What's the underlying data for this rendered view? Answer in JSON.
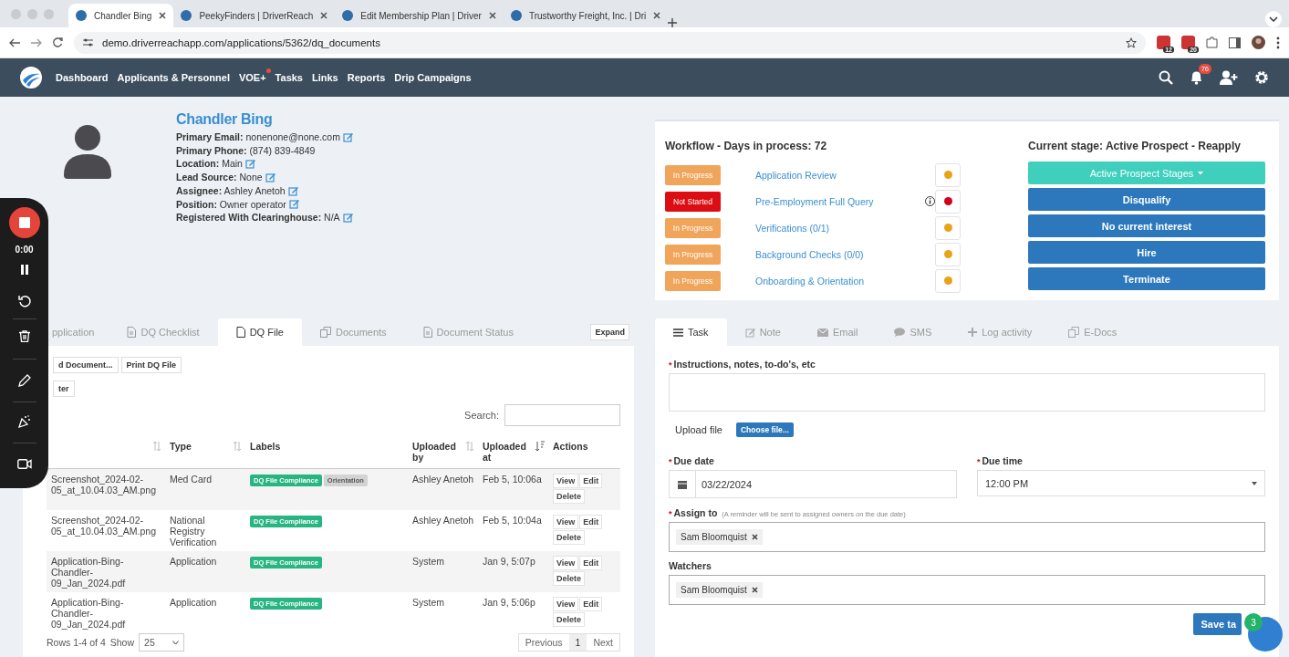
{
  "browser": {
    "tabs": [
      {
        "title": "Chandler Bing",
        "selected": true
      },
      {
        "title": "PeekyFinders | DriverReach",
        "selected": false
      },
      {
        "title": "Edit Membership Plan | Driver",
        "selected": false
      },
      {
        "title": "Trustworthy Freight, Inc. | Dri",
        "selected": false
      }
    ],
    "url": "demo.driverreachapp.com/applications/5362/dq_documents",
    "extension_badges": [
      "12",
      "20"
    ]
  },
  "nav": {
    "items": [
      {
        "label": "Dashboard",
        "alert": false
      },
      {
        "label": "Applicants & Personnel",
        "alert": false
      },
      {
        "label": "VOE+",
        "alert": true
      },
      {
        "label": "Tasks",
        "alert": false
      },
      {
        "label": "Links",
        "alert": false
      },
      {
        "label": "Reports",
        "alert": false
      },
      {
        "label": "Drip Campaigns",
        "alert": false
      }
    ],
    "notification_count": "76"
  },
  "profile": {
    "name": "Chandler Bing",
    "fields": [
      {
        "label": "Primary Email:",
        "value": "nonenone@none.com",
        "editable": true
      },
      {
        "label": "Primary Phone:",
        "value": "(874) 839-4849",
        "editable": false
      },
      {
        "label": "Location:",
        "value": "Main",
        "editable": true
      },
      {
        "label": "Lead Source:",
        "value": "None",
        "editable": true
      },
      {
        "label": "Assignee:",
        "value": "Ashley Anetoh",
        "editable": true
      },
      {
        "label": "Position:",
        "value": "Owner operator",
        "editable": true
      },
      {
        "label": "Registered With Clearinghouse:",
        "value": "N/A",
        "editable": true
      }
    ]
  },
  "workflow": {
    "title": "Workflow - Days in process: 72",
    "items": [
      {
        "status": "In Progress",
        "kind": "in_progress",
        "name": "Application Review",
        "color": "#e8a317",
        "info": false
      },
      {
        "status": "Not Started",
        "kind": "not_started",
        "name": "Pre-Employment Full Query",
        "color": "#d0021b",
        "info": true
      },
      {
        "status": "In Progress",
        "kind": "in_progress",
        "name": "Verifications (0/1)",
        "color": "#e8a317",
        "info": false
      },
      {
        "status": "In Progress",
        "kind": "in_progress",
        "name": "Background Checks (0/0)",
        "color": "#e8a317",
        "info": false
      },
      {
        "status": "In Progress",
        "kind": "in_progress",
        "name": "Onboarding & Orientation",
        "color": "#e8a317",
        "info": false
      }
    ]
  },
  "stage": {
    "title": "Current stage: Active Prospect - Reapply",
    "dropdown": "Active Prospect Stages",
    "buttons": [
      "Disqualify",
      "No current interest",
      "Hire",
      "Terminate"
    ]
  },
  "documents": {
    "tabs": [
      {
        "label": "pplication",
        "selected": false
      },
      {
        "label": "DQ Checklist",
        "selected": false
      },
      {
        "label": "DQ File",
        "selected": true
      },
      {
        "label": "Documents",
        "selected": false
      },
      {
        "label": "Document Status",
        "selected": false
      }
    ],
    "expand": "Expand",
    "buttons": [
      "d Document...",
      "Print DQ File",
      "ter"
    ],
    "search_label": "Search:",
    "columns": [
      {
        "sortable": true,
        "sorted": false
      },
      {
        "label": "Type",
        "sortable": true,
        "sorted": false
      },
      {
        "label": "Labels",
        "sortable": false
      },
      {
        "label": "Uploaded by",
        "sortable": true,
        "sorted": false
      },
      {
        "label": "Uploaded at",
        "sortable": true,
        "sorted": true
      },
      {
        "label": "Actions",
        "sortable": false
      }
    ],
    "rows": [
      {
        "file": "Screenshot_2024-02-05_at_10.04.03_AM.png",
        "type": "Med Card",
        "labels": [
          {
            "text": "DQ File Compliance",
            "kind": "compliance"
          },
          {
            "text": "Orientation",
            "kind": "neutral"
          }
        ],
        "uploaded_by": "Ashley Anetoh",
        "uploaded_at": "Feb 5, 10:06a",
        "actions": [
          "View",
          "Edit",
          "Delete"
        ]
      },
      {
        "file": "Screenshot_2024-02-05_at_10.04.03_AM.png",
        "type": "National Registry Verification",
        "labels": [
          {
            "text": "DQ File Compliance",
            "kind": "compliance"
          }
        ],
        "uploaded_by": "Ashley Anetoh",
        "uploaded_at": "Feb 5, 10:04a",
        "actions": [
          "View",
          "Edit",
          "Delete"
        ]
      },
      {
        "file": "Application-Bing-Chandler-09_Jan_2024.pdf",
        "type": "Application",
        "labels": [
          {
            "text": "DQ File Compliance",
            "kind": "compliance"
          }
        ],
        "uploaded_by": "System",
        "uploaded_at": "Jan 9, 5:07p",
        "actions": [
          "View",
          "Edit",
          "Delete"
        ]
      },
      {
        "file": "Application-Bing-Chandler-09_Jan_2024.pdf",
        "type": "Application",
        "labels": [
          {
            "text": "DQ File Compliance",
            "kind": "compliance"
          }
        ],
        "uploaded_by": "System",
        "uploaded_at": "Jan 9, 5:06p",
        "actions": [
          "View",
          "Edit",
          "Delete"
        ]
      }
    ],
    "footer": {
      "rows_info": "Rows 1-4 of 4",
      "show_label": "Show",
      "page_size": "25",
      "pages": [
        {
          "label": "Previous",
          "selected": false
        },
        {
          "label": "1",
          "selected": true
        },
        {
          "label": "Next",
          "selected": false
        }
      ]
    }
  },
  "task": {
    "tabs": [
      {
        "label": "Task",
        "selected": true
      },
      {
        "label": "Note",
        "selected": false
      },
      {
        "label": "Email",
        "selected": false
      },
      {
        "label": "SMS",
        "selected": false
      },
      {
        "label": "Log activity",
        "selected": false
      },
      {
        "label": "E-Docs",
        "selected": false
      }
    ],
    "required_mark": "*",
    "instructions_label": "Instructions, notes, to-do's, etc",
    "upload_label": "Upload file",
    "choose_file": "Choose file...",
    "due_date_label": "Due date",
    "due_date": "03/22/2024",
    "due_time_label": "Due time",
    "due_time": "12:00 PM",
    "assign_label": "Assign to",
    "assign_hint": "(A reminder will be sent to assigned owners on the due date)",
    "assignees": [
      "Sam Bloomquist"
    ],
    "watchers_label": "Watchers",
    "watchers": [
      "Sam Bloomquist"
    ],
    "save": "Save ta"
  },
  "chat_widget": {
    "badge": "3"
  },
  "recorder": {
    "time": "0:00"
  }
}
